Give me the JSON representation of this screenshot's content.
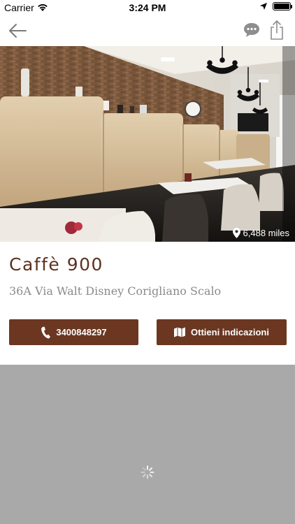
{
  "status_bar": {
    "carrier": "Carrier",
    "time": "3:24 PM"
  },
  "nav": {
    "back_icon": "arrow-left-icon",
    "chat_icon": "chat-bubble-icon",
    "share_icon": "share-icon"
  },
  "hero": {
    "distance": "6,488 miles",
    "pin_icon": "location-pin-icon"
  },
  "place": {
    "name": "Caffè 900",
    "address": "36A Via Walt Disney Corigliano Scalo"
  },
  "actions": {
    "call_label": "3400848297",
    "call_icon": "phone-icon",
    "directions_label": "Ottieni indicazioni",
    "directions_icon": "map-icon"
  },
  "colors": {
    "brand_brown": "#6b3721",
    "title_brown": "#5c3220",
    "map_placeholder": "#a9a9a9"
  }
}
